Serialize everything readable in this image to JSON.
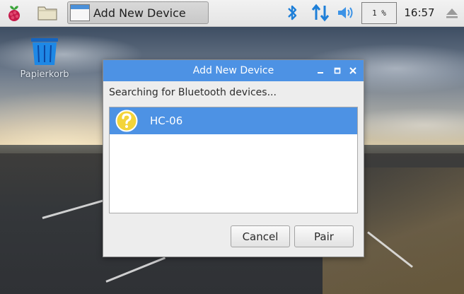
{
  "taskbar": {
    "menu_icon": "raspberry-pi-icon",
    "file_manager_icon": "folder-icon",
    "task_label": "Add New Device",
    "bluetooth_icon": "bluetooth-icon",
    "network_icon": "network-arrows-icon",
    "volume_icon": "volume-icon",
    "cpu_usage": "1 %",
    "clock": "16:57",
    "eject_icon": "eject-icon",
    "accent_color": "#1e7fd8"
  },
  "desktop": {
    "trash_label": "Papierkorb"
  },
  "dialog": {
    "title": "Add New Device",
    "status": "Searching for Bluetooth devices...",
    "titlebar_color": "#4d92e4",
    "devices": [
      {
        "name": "HC-06",
        "icon": "question-mark-icon",
        "selected": true
      }
    ],
    "buttons": {
      "cancel": "Cancel",
      "pair": "Pair"
    }
  }
}
